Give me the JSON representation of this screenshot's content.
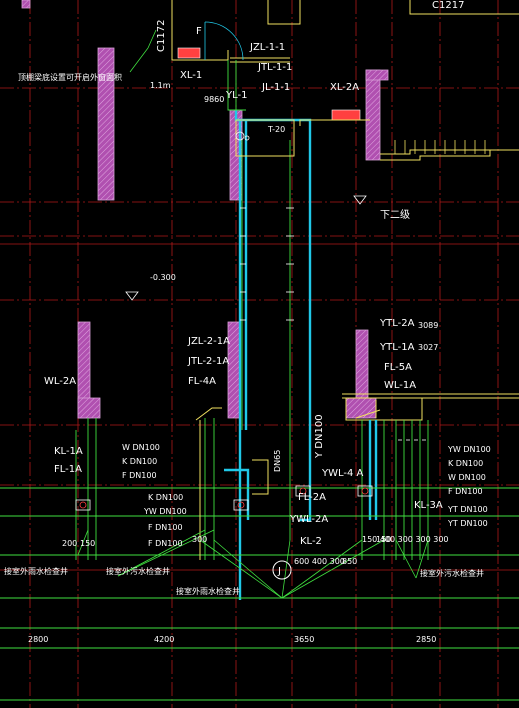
{
  "labels": {
    "c1172": "C1172",
    "c1217": "C1217",
    "f_mark": "F",
    "jzl_1_1": "JZL-1-1",
    "jtl_1_1": "JTL-1-1",
    "xl_1": "XL-1",
    "jl_1_1": "JL-1-1",
    "yl_1": "YL-1",
    "xl_2a": "XL-2A",
    "m1_note": "1.1m",
    "note_cn": "顶棚梁底设置可开启外窗面积",
    "v9860": "9860",
    "t20": "T-20",
    "xia_er_ji": "下二级",
    "level_minus": "-0.300",
    "ytl_2a": "YTL-2A",
    "ytl_1a": "YTL-1A",
    "fl_5a": "FL-5A",
    "wl_1a": "WL-1A",
    "v3089": "3089",
    "v3027": "3027",
    "jzl_2_1a": "JZL-2-1A",
    "jtl_2_1a": "JTL-2-1A",
    "fl_4a": "FL-4A",
    "wl_2a": "WL-2A",
    "kl_1a": "KL-1A",
    "fl_1a": "FL-1A",
    "w_dn100_a": "W DN100",
    "k_dn100_a": "K DN100",
    "f_dn100_a": "F DN100",
    "dn65": "DN65",
    "y_dn100": "Y DN100",
    "ywl_4a": "YWL-4 A",
    "yw_dn100_r": "YW DN100",
    "k_dn100_r": "K DN100",
    "w_dn100_r": "W DN100",
    "f_dn100_r": "F DN100",
    "yt_dn100_r1": "YT DN100",
    "yt_dn100_r2": "YT DN100",
    "kl_3a": "KL-3A",
    "k_dn100_m": "K DN100",
    "yw_dn100_m": "YW DN100",
    "f_dn100_m": "F DN100",
    "f_dn100_m2": "F DN100",
    "fl_2a": "FL-2A",
    "ywl_2a": "YWL-2A",
    "kl_2": "KL-2",
    "circle_j": "J",
    "dim_200": "200",
    "dim_150": "150",
    "dim_300": "300",
    "dim_600_400_300": "600 400 300",
    "dim_850": "850",
    "dim_150b": "150",
    "dim_right": "150 400 300 300 300",
    "jie_left": "接室外雨水检查井",
    "jie_mid": "接室外污水检查井",
    "jie_bottom": "接室外雨水检查井",
    "jie_right": "接室外污水检查井",
    "bottom_2800": "2800",
    "bottom_4200": "4200",
    "bottom_3650": "3650",
    "bottom_2850": "2850"
  },
  "colors": {
    "wall_fill": "#b050b0",
    "wall_hatch": "#d8a0d8",
    "grid_red": "#b01818",
    "pipe_green": "#40e040",
    "pipe_cyan": "#20c8e8",
    "pipe_yellow": "#f0e060",
    "text": "#ffffff",
    "dim_green": "#40ff40",
    "pipe_red": "#ff4040"
  }
}
